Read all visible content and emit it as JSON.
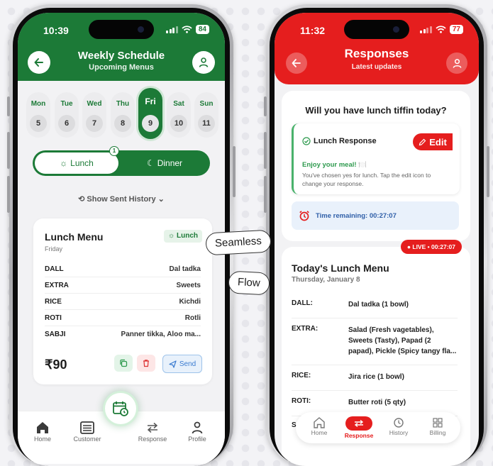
{
  "left_phone": {
    "status": {
      "time": "10:39",
      "battery": "84"
    },
    "header": {
      "title": "Weekly Schedule",
      "subtitle": "Upcoming Menus"
    },
    "days": [
      {
        "name": "Mon",
        "date": "5"
      },
      {
        "name": "Tue",
        "date": "6"
      },
      {
        "name": "Wed",
        "date": "7"
      },
      {
        "name": "Thu",
        "date": "8"
      },
      {
        "name": "Fri",
        "date": "9",
        "selected": true
      },
      {
        "name": "Sat",
        "date": "10"
      },
      {
        "name": "Sun",
        "date": "11"
      }
    ],
    "toggle": {
      "lunch": "Lunch",
      "dinner": "Dinner",
      "lunch_badge": "1"
    },
    "history_link": "Show Sent History",
    "menu_card": {
      "title": "Lunch Menu",
      "day": "Friday",
      "chip": "Lunch",
      "rows": [
        {
          "label": "DALL",
          "value": "Dal tadka"
        },
        {
          "label": "EXTRA",
          "value": "Sweets"
        },
        {
          "label": "RICE",
          "value": "Kichdi"
        },
        {
          "label": "ROTI",
          "value": "Rotli"
        },
        {
          "label": "SABJI",
          "value": "Panner tikka, Aloo ma..."
        }
      ],
      "price": "₹90",
      "send_label": "Send"
    },
    "nav": [
      {
        "label": "Home",
        "icon": "home-icon"
      },
      {
        "label": "Customer",
        "icon": "list-icon"
      },
      {
        "label": "Response",
        "icon": "arrows-icon"
      },
      {
        "label": "Profile",
        "icon": "user-icon"
      }
    ],
    "colors": {
      "primary": "#1c7a37"
    }
  },
  "callouts": {
    "seamless": "Seamless",
    "flow": "Flow"
  },
  "right_phone": {
    "status": {
      "time": "11:32",
      "battery": "77"
    },
    "header": {
      "title": "Responses",
      "subtitle": "Latest updates"
    },
    "question": "Will you have lunch tiffin today?",
    "response": {
      "label": "Lunch Response",
      "edit": "Edit",
      "enjoy": "Enjoy your meal! 🍽️",
      "description": "You've chosen yes for lunch. Tap the edit icon to change your response."
    },
    "timer": "Time remaining: 00:27:07",
    "live_pill": "● LIVE • 00:27:07",
    "today": {
      "title": "Today's Lunch Menu",
      "date": "Thursday, January 8",
      "rows": [
        {
          "label": "DALL:",
          "value": "Dal tadka (1 bowl)"
        },
        {
          "label": "EXTRA:",
          "value": "Salad (Fresh vagetables), Sweets (Tasty), Papad (2 papad), Pickle (Spicy tangy fla..."
        },
        {
          "label": "RICE:",
          "value": "Jira rice (1 bowl)"
        },
        {
          "label": "ROTI:",
          "value": "Butter roti (5 qty)"
        },
        {
          "label": "S",
          "value": ""
        }
      ]
    },
    "nav": [
      {
        "label": "Home",
        "icon": "home-icon"
      },
      {
        "label": "Response",
        "icon": "arrows-icon",
        "active": true
      },
      {
        "label": "History",
        "icon": "history-icon"
      },
      {
        "label": "Billing",
        "icon": "grid-icon"
      }
    ],
    "colors": {
      "primary": "#e51e1e"
    }
  }
}
